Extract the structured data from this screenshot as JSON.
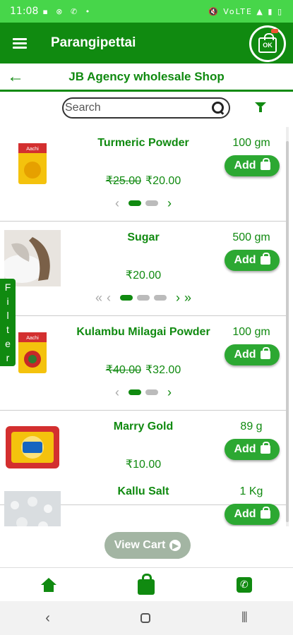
{
  "status_bar": {
    "time": "11:08",
    "notifications": "▪ ⊗ ✆ •",
    "system": "🔇 VoLTE ▲ ▮ ▯"
  },
  "app_bar": {
    "title": "Parangipettai",
    "logo_text": "OK"
  },
  "shop": {
    "name": "JB Agency wholesale Shop"
  },
  "search": {
    "placeholder": "Search"
  },
  "filter_tab": {
    "label": [
      "F",
      "i",
      "l",
      "t",
      "e",
      "r"
    ]
  },
  "products": [
    {
      "name": "Turmeric Powder",
      "qty": "100 gm",
      "mrp": "₹25.00",
      "price": "₹20.00",
      "add": "Add",
      "pages": 2,
      "active_page": 1
    },
    {
      "name": "Sugar",
      "qty": "500 gm",
      "mrp": "",
      "price": "₹20.00",
      "add": "Add",
      "pages": 3,
      "active_page": 1
    },
    {
      "name": "Kulambu Milagai Powder",
      "qty": "100 gm",
      "mrp": "₹40.00",
      "price": "₹32.00",
      "add": "Add",
      "pages": 2,
      "active_page": 1
    },
    {
      "name": "Marry Gold",
      "qty": "89 g",
      "mrp": "",
      "price": "₹10.00",
      "add": "Add",
      "pages": 0,
      "active_page": 0
    },
    {
      "name": "Kallu Salt",
      "qty": "1 Kg",
      "mrp": "",
      "price": "",
      "add": "Add",
      "pages": 0,
      "active_page": 0
    }
  ],
  "view_cart": {
    "label": "View Cart"
  },
  "colors": {
    "primary": "#108a10",
    "status": "#47d64a",
    "add_button": "#2ca832",
    "view_cart": "#a3b5a3"
  },
  "icons": {
    "menu": "menu-icon",
    "back": "back-arrow-icon",
    "search": "search-icon",
    "filter": "filter-icon",
    "home": "home-icon",
    "cart": "shopping-bag-icon",
    "phone": "phone-icon"
  }
}
